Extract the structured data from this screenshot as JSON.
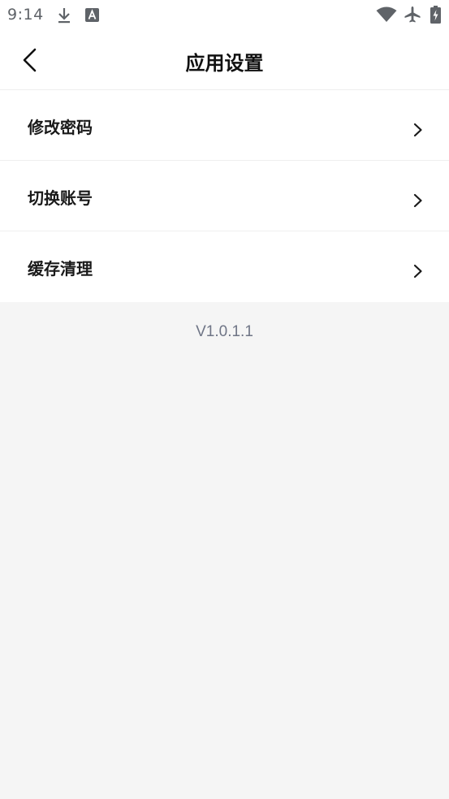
{
  "status_bar": {
    "time": "9:14",
    "icons": [
      "download-icon",
      "a-notification-icon",
      "wifi-icon",
      "airplane-mode-icon",
      "battery-icon"
    ]
  },
  "header": {
    "title": "应用设置",
    "back_icon": "back-arrow-icon"
  },
  "menu": {
    "items": [
      {
        "label": "修改密码",
        "icon": "chevron-right-icon"
      },
      {
        "label": "切换账号",
        "icon": "chevron-right-icon"
      },
      {
        "label": "缓存清理",
        "icon": "chevron-right-icon"
      }
    ]
  },
  "footer": {
    "version": "V1.0.1.1"
  },
  "colors": {
    "background": "#f5f5f5",
    "surface": "#ffffff",
    "text_primary": "#111111",
    "text_secondary": "#6f7586",
    "status_icon": "#5f6368"
  }
}
